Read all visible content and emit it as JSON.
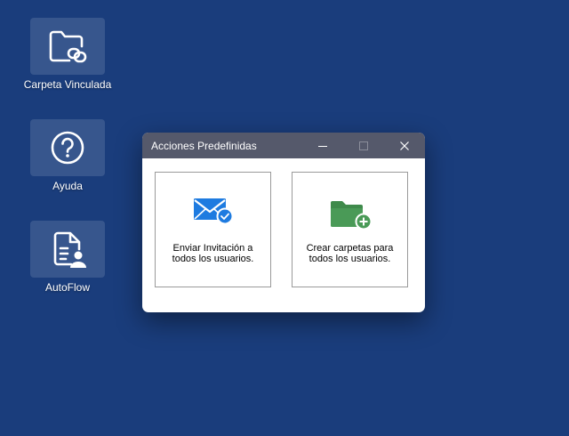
{
  "desktop": {
    "icons": [
      {
        "label": "Carpeta Vinculada",
        "icon": "linked-folder-icon"
      },
      {
        "label": "Ayuda",
        "icon": "help-icon"
      },
      {
        "label": "AutoFlow",
        "icon": "document-user-icon"
      }
    ]
  },
  "window": {
    "title": "Acciones Predefinidas",
    "actions": [
      {
        "line1": "Enviar Invitación a",
        "line2": "todos los usuarios.",
        "icon": "mail-check-icon"
      },
      {
        "line1": "Crear carpetas para",
        "line2": "todos los usuarios.",
        "icon": "folder-add-icon"
      }
    ]
  },
  "colors": {
    "desktop_background": "#1a3d7c",
    "titlebar": "#55596b",
    "mail_blue": "#1e7be0",
    "folder_green": "#4a9a57"
  }
}
